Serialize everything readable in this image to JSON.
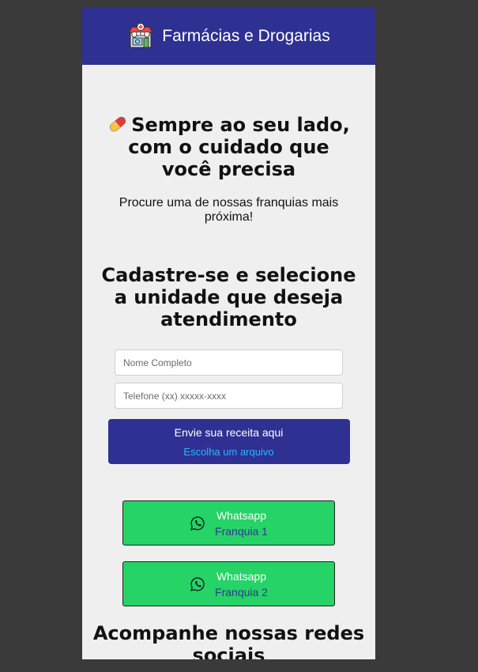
{
  "header": {
    "title": "Farmácias e Drogarias",
    "icon": "pharmacy-store-icon"
  },
  "hero": {
    "icon": "pill-capsule-icon",
    "title": "Sempre ao seu lado, com o cuidado que você precisa",
    "subtitle": "Procure uma de nossas franquias mais próxima!"
  },
  "register": {
    "title": "Cadastre-se e selecione a unidade que deseja atendimento",
    "name_placeholder": "Nome Completo",
    "phone_placeholder": "Telefone (xx) xxxxx-xxxx",
    "upload_label": "Envie sua receita aqui",
    "upload_choose": "Escolha um arquivo"
  },
  "whatsapp": [
    {
      "title": "Whatsapp",
      "subtitle": "Franquia 1"
    },
    {
      "title": "Whatsapp",
      "subtitle": "Franquia 2"
    }
  ],
  "social": {
    "title": "Acompanhe nossas redes sociais"
  },
  "colors": {
    "brand": "#2e3192",
    "whatsapp": "#25d366",
    "link": "#29b6ff",
    "background": "#efefef",
    "outer": "#3a3a3a"
  }
}
